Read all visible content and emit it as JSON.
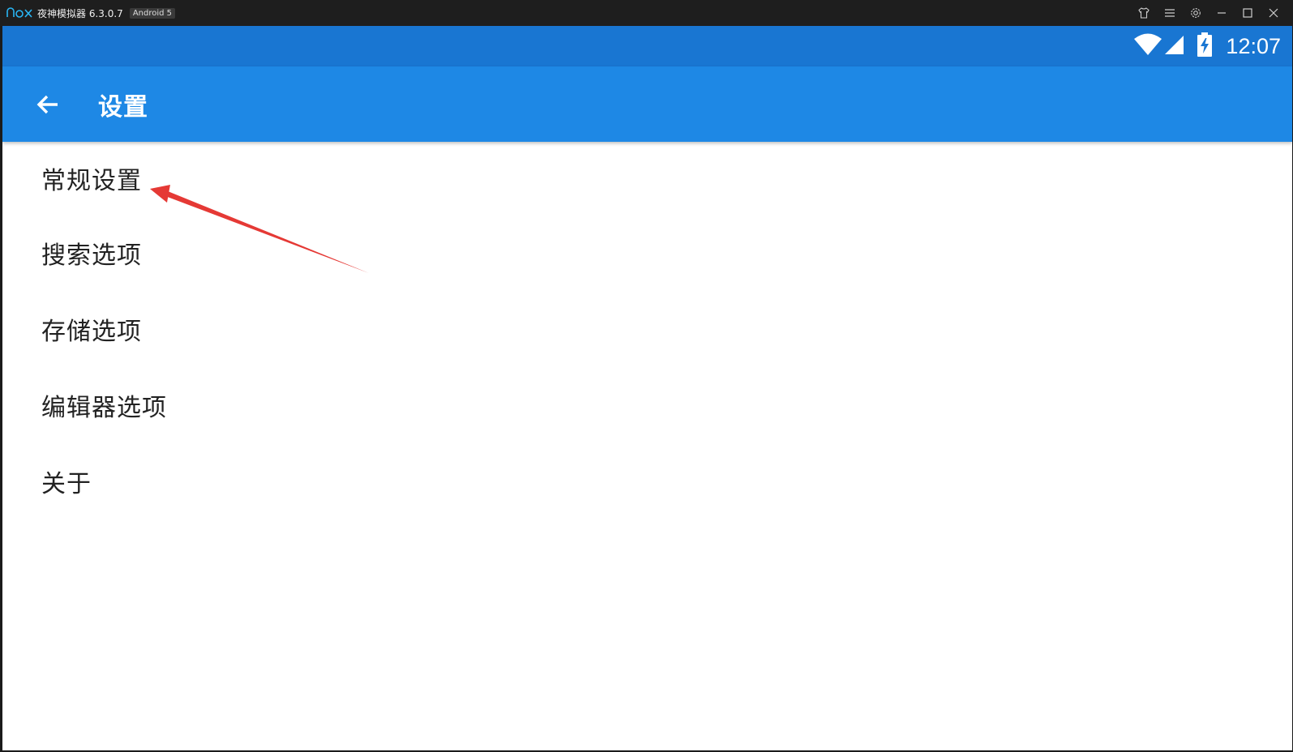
{
  "window": {
    "app_name": "夜神模拟器 6.3.0.7",
    "android_badge": "Android 5",
    "controls": [
      "shirt-icon",
      "menu-icon",
      "gear-icon",
      "minimize-icon",
      "maximize-icon",
      "close-icon"
    ]
  },
  "status_bar": {
    "time": "12:07",
    "icons": [
      "wifi-icon",
      "signal-icon",
      "battery-charging-icon"
    ]
  },
  "app_bar": {
    "title": "设置"
  },
  "settings": {
    "items": [
      {
        "label": "常规设置"
      },
      {
        "label": "搜索选项"
      },
      {
        "label": "存储选项"
      },
      {
        "label": "编辑器选项"
      },
      {
        "label": "关于"
      }
    ]
  },
  "colors": {
    "status_bar": "#1976d2",
    "app_bar": "#1e88e5",
    "annotation_arrow": "#e53935"
  }
}
